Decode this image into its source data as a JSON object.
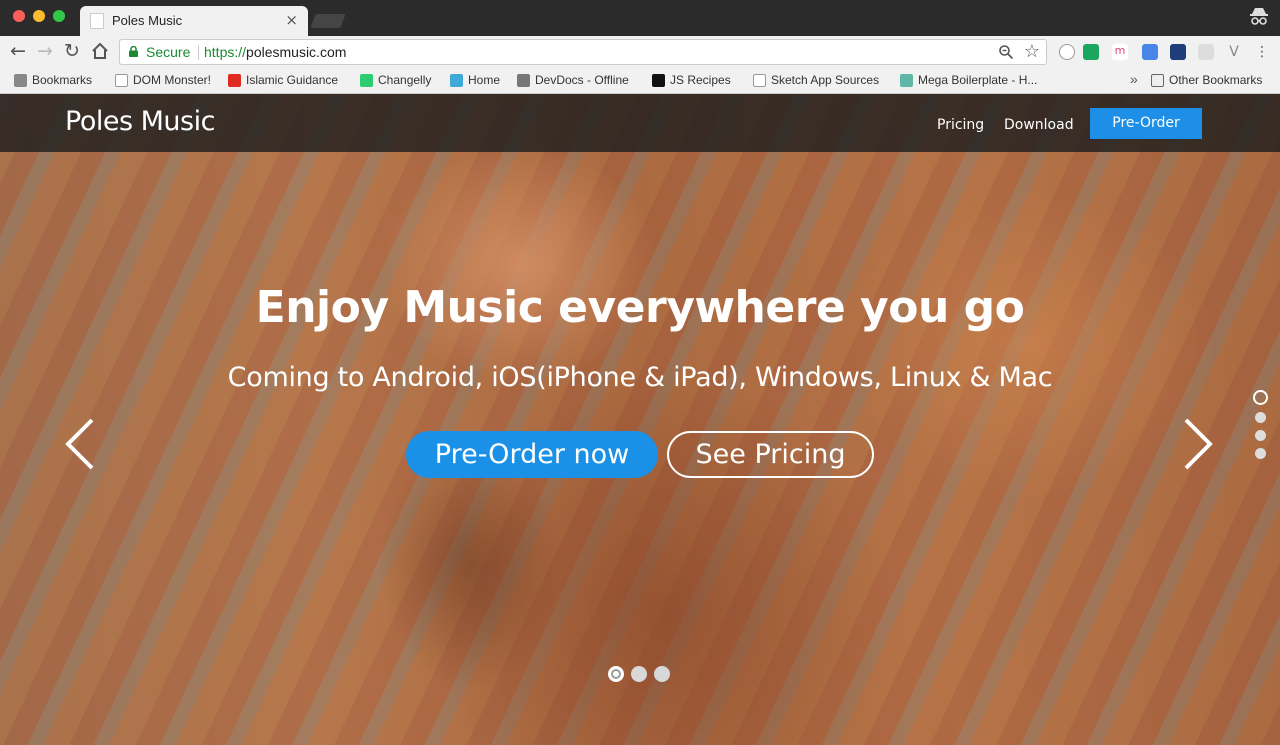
{
  "browser": {
    "tab_title": "Poles Music",
    "tab_close": "×",
    "secure_label": "Secure",
    "url_scheme": "https://",
    "url_host": "polesmusic.com",
    "bookmarks": [
      {
        "label": "Bookmarks",
        "icon": "star-icon",
        "color": "#888888"
      },
      {
        "label": "DOM Monster!",
        "icon": "page-icon",
        "color": "#ffffff"
      },
      {
        "label": "Islamic Guidance",
        "icon": "youtube-icon",
        "color": "#e02b20"
      },
      {
        "label": "Changelly",
        "icon": "changelly-icon",
        "color": "#2ecc71"
      },
      {
        "label": "Home",
        "icon": "flutter-icon",
        "color": "#3fa9d8"
      },
      {
        "label": "DevDocs - Offline",
        "icon": "devdocs-icon",
        "color": "#777777"
      },
      {
        "label": "JS Recipes",
        "icon": "terminal-icon",
        "color": "#111111"
      },
      {
        "label": "Sketch App Sources",
        "icon": "page-icon",
        "color": "#ffffff"
      },
      {
        "label": "Mega Boilerplate - H...",
        "icon": "boilerplate-icon",
        "color": "#5fb7a8"
      }
    ],
    "more_bookmarks": "»",
    "other_bookmarks": "Other Bookmarks"
  },
  "site": {
    "brand": "Poles Music",
    "nav": {
      "pricing": "Pricing",
      "download": "Download",
      "preorder": "Pre-Order"
    },
    "hero": {
      "headline": "Enjoy Music everywhere you go",
      "subline": "Coming to Android, iOS(iPhone & iPad), Windows, Linux & Mac",
      "primary_button": "Pre-Order now",
      "secondary_button": "See Pricing",
      "slide_count": 3,
      "active_slide": 1,
      "vertical_indicator_count": 4,
      "vertical_active": 1
    },
    "colors": {
      "accent": "#1a90e6",
      "navbar": "#1e1e1e"
    }
  }
}
